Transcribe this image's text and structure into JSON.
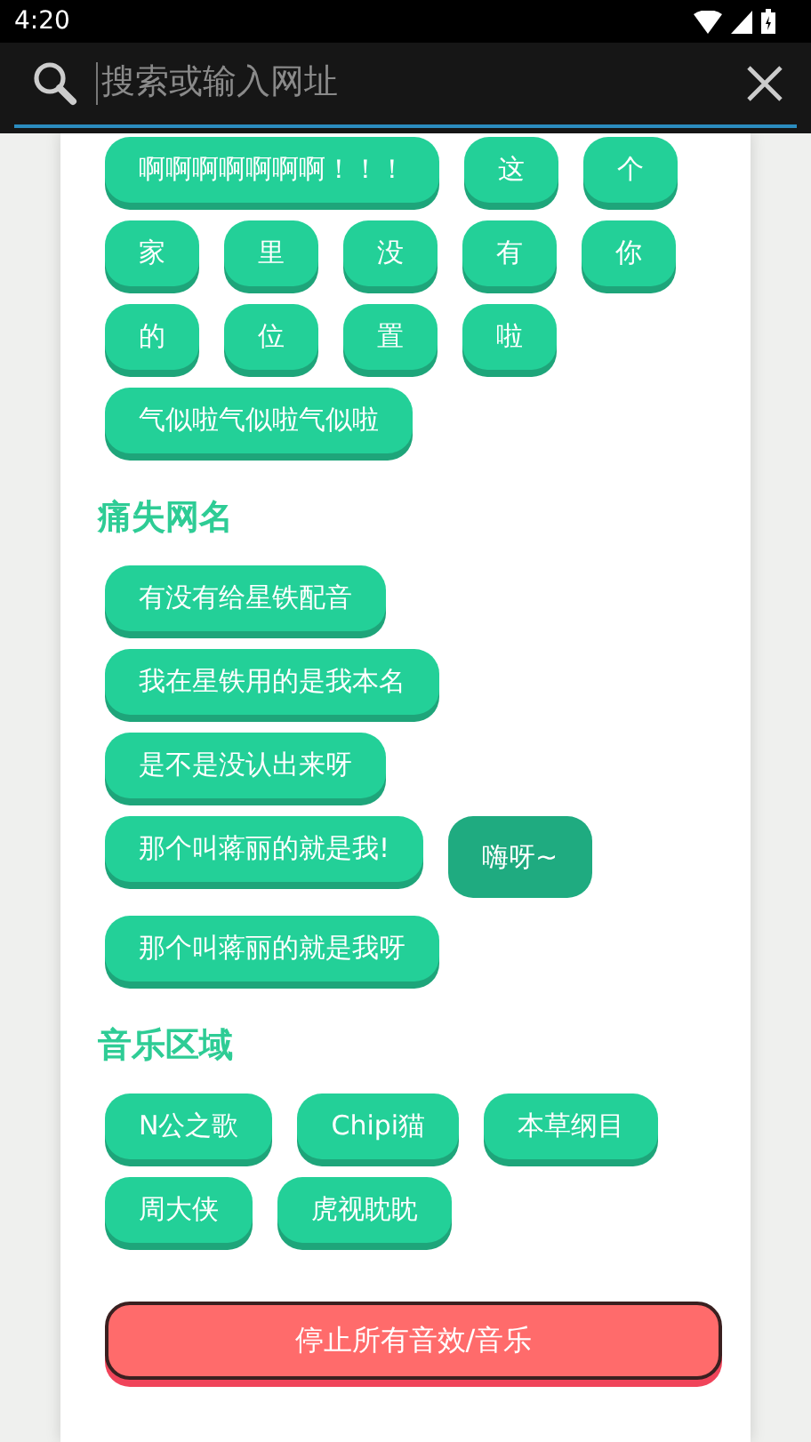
{
  "status_bar": {
    "time": "4:20"
  },
  "search": {
    "placeholder": "搜索或输入网址"
  },
  "sections": [
    {
      "buttons": [
        {
          "label": "啊啊啊啊啊啊啊！！！",
          "selected": false
        },
        {
          "label": "这",
          "selected": false
        },
        {
          "label": "个",
          "selected": false
        },
        {
          "label": "家",
          "selected": false
        },
        {
          "label": "里",
          "selected": false
        },
        {
          "label": "没",
          "selected": false
        },
        {
          "label": "有",
          "selected": false
        },
        {
          "label": "你",
          "selected": false
        },
        {
          "label": "的",
          "selected": false
        },
        {
          "label": "位",
          "selected": false
        },
        {
          "label": "置",
          "selected": false
        },
        {
          "label": "啦",
          "selected": false
        },
        {
          "label": "气似啦气似啦气似啦",
          "selected": false
        }
      ]
    },
    {
      "title": "痛失网名",
      "buttons": [
        {
          "label": "有没有给星铁配音",
          "selected": false
        },
        {
          "label": "我在星铁用的是我本名",
          "selected": false
        },
        {
          "label": "是不是没认出来呀",
          "selected": false
        },
        {
          "label": "那个叫蒋丽的就是我!",
          "selected": false
        },
        {
          "label": "嗨呀~",
          "selected": true
        },
        {
          "label": "那个叫蒋丽的就是我呀",
          "selected": false
        }
      ]
    },
    {
      "title": "音乐区域",
      "buttons": [
        {
          "label": "N公之歌",
          "selected": false
        },
        {
          "label": "Chipi猫",
          "selected": false
        },
        {
          "label": "本草纲目",
          "selected": false
        },
        {
          "label": "周大侠",
          "selected": false
        },
        {
          "label": "虎视眈眈",
          "selected": false
        }
      ]
    }
  ],
  "stop_button": {
    "label": "停止所有音效/音乐"
  }
}
